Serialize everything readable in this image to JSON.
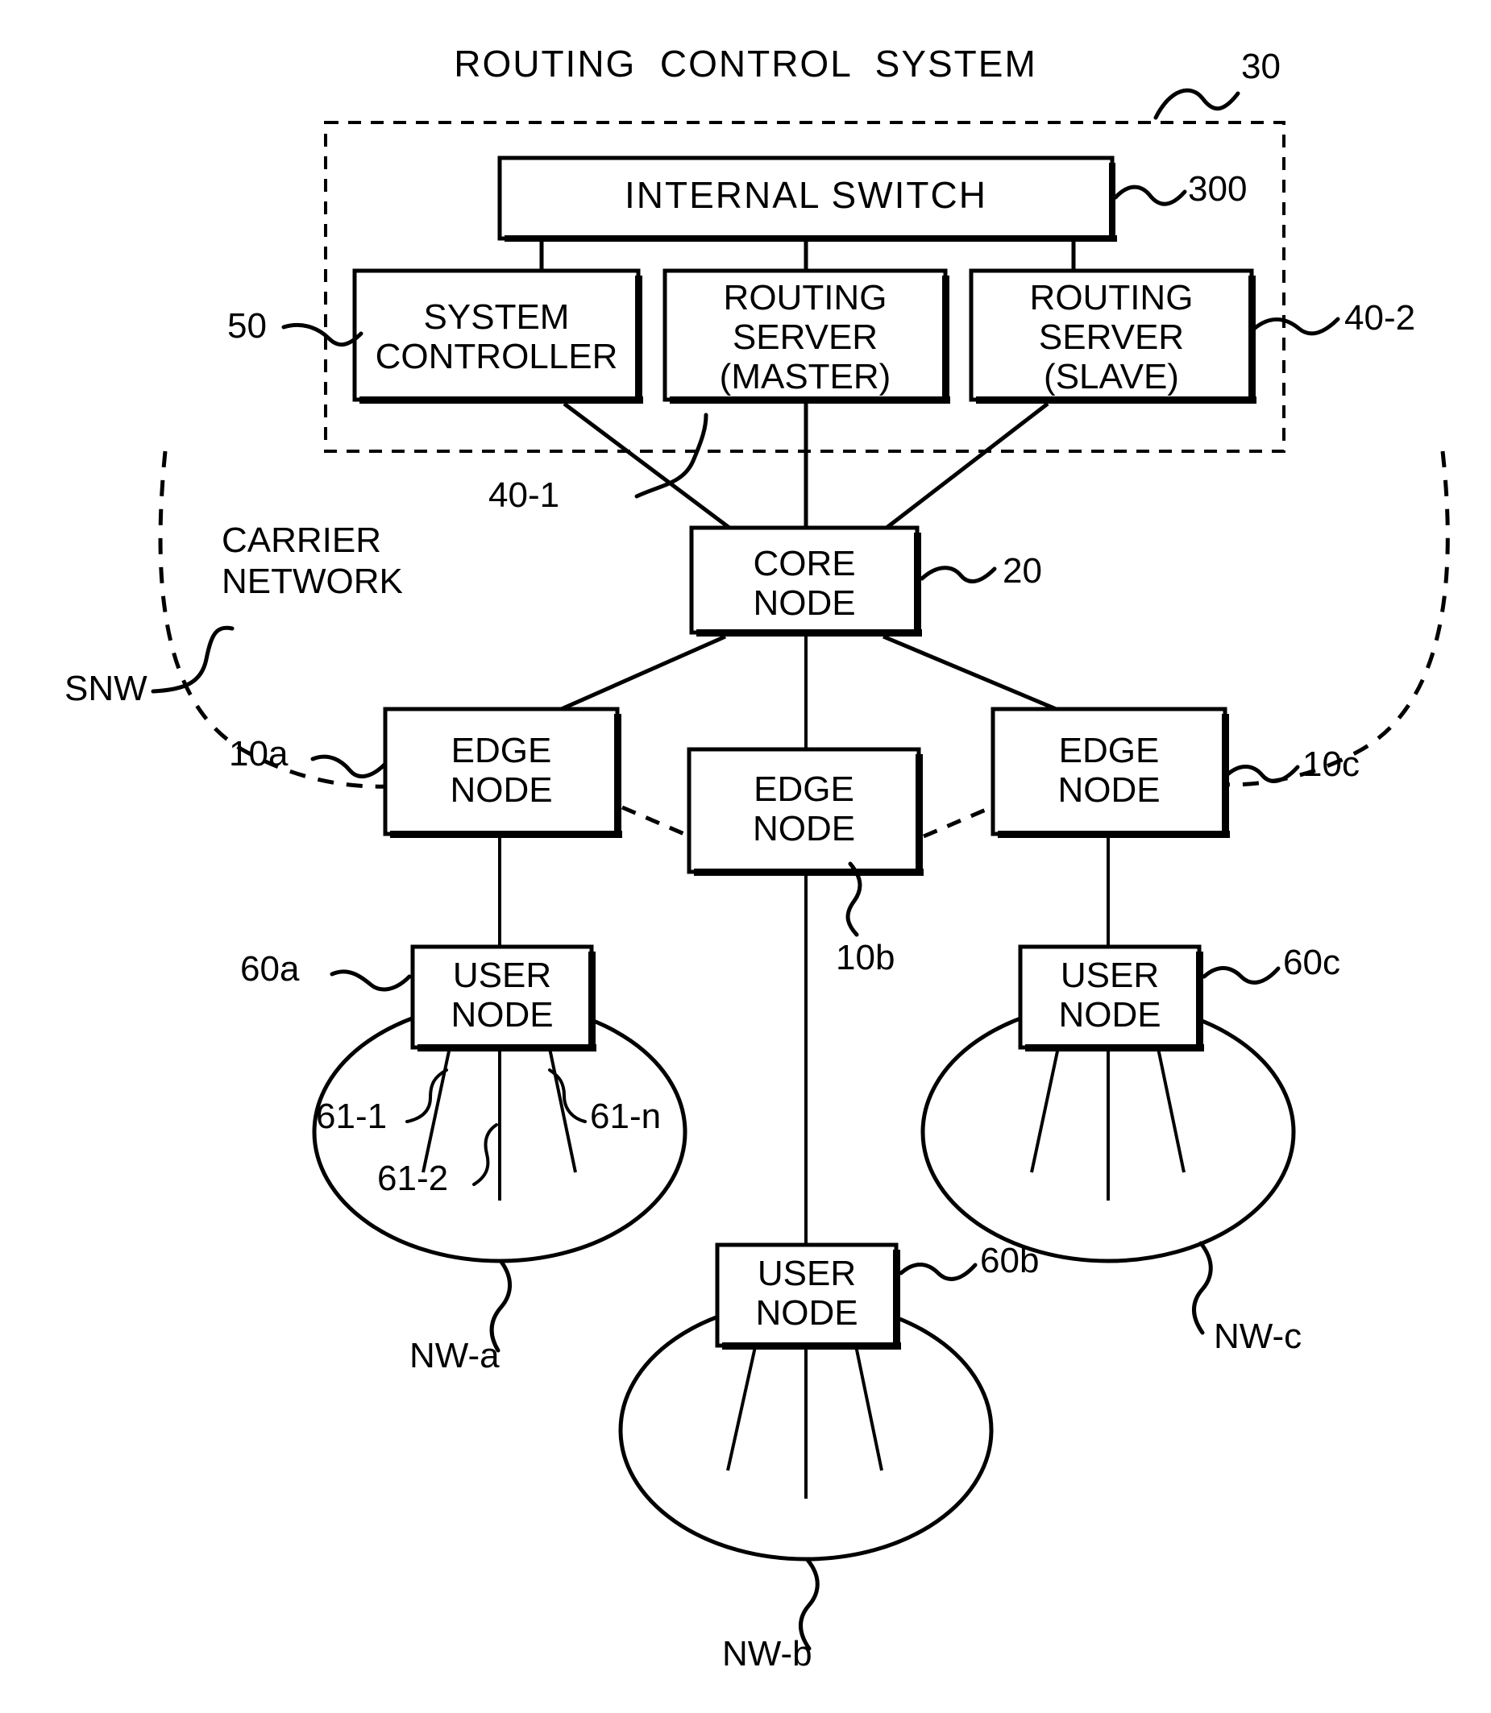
{
  "figure": {
    "title": "ROUTING  CONTROL  SYSTEM",
    "domain": "patent-network-diagram"
  },
  "nodes": {
    "internal_switch": {
      "label": "INTERNAL SWITCH",
      "ref": "300"
    },
    "system_controller": {
      "label_line1": "SYSTEM",
      "label_line2": "CONTROLLER",
      "ref": "50"
    },
    "routing_server_master": {
      "label_line1": "ROUTING",
      "label_line2": "SERVER",
      "label_line3": "(MASTER)",
      "ref": "40-1"
    },
    "routing_server_slave": {
      "label_line1": "ROUTING",
      "label_line2": "SERVER",
      "label_line3": "(SLAVE)",
      "ref": "40-2"
    },
    "core_node": {
      "label_line1": "CORE",
      "label_line2": "NODE",
      "ref": "20"
    },
    "edge_node_a": {
      "label_line1": "EDGE",
      "label_line2": "NODE",
      "ref": "10a"
    },
    "edge_node_b": {
      "label_line1": "EDGE",
      "label_line2": "NODE",
      "ref": "10b"
    },
    "edge_node_c": {
      "label_line1": "EDGE",
      "label_line2": "NODE",
      "ref": "10c"
    },
    "user_node_a": {
      "label_line1": "USER",
      "label_line2": "NODE",
      "ref": "60a"
    },
    "user_node_b": {
      "label_line1": "USER",
      "label_line2": "NODE",
      "ref": "60b"
    },
    "user_node_c": {
      "label_line1": "USER",
      "label_line2": "NODE",
      "ref": "60c"
    }
  },
  "boundaries": {
    "routing_control_system": {
      "ref": "30"
    },
    "carrier_network": {
      "label_line1": "CARRIER",
      "label_line2": "NETWORK",
      "ref": "SNW"
    }
  },
  "networks": {
    "nw_a": {
      "ref": "NW-a"
    },
    "nw_b": {
      "ref": "NW-b"
    },
    "nw_c": {
      "ref": "NW-c"
    }
  },
  "terminals": {
    "t1": "61-1",
    "t2": "61-2",
    "tn": "61-n"
  },
  "colors": {
    "stroke": "#000000",
    "background": "#ffffff"
  }
}
